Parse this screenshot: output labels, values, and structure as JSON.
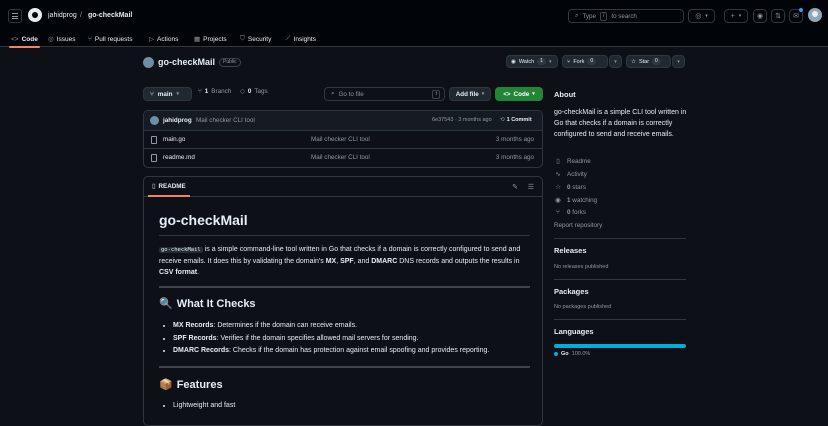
{
  "header": {
    "owner": "jahidprog",
    "separator": "/",
    "repo": "go-checkMail",
    "search_prefix": "Type",
    "search_key": "/",
    "search_suffix": "to search",
    "plus": "+",
    "caret": "▾"
  },
  "nav": {
    "tabs": [
      {
        "label": "Code",
        "icon": "code-icon"
      },
      {
        "label": "Issues",
        "icon": "issue-icon"
      },
      {
        "label": "Pull requests",
        "icon": "pull-request-icon"
      },
      {
        "label": "Actions",
        "icon": "play-icon"
      },
      {
        "label": "Projects",
        "icon": "table-icon"
      },
      {
        "label": "Security",
        "icon": "shield-icon"
      },
      {
        "label": "Insights",
        "icon": "graph-icon"
      }
    ]
  },
  "repo": {
    "name": "go-checkMail",
    "visibility": "Public",
    "watch_label": "Watch",
    "watch_count": "1",
    "fork_label": "Fork",
    "fork_count": "0",
    "star_label": "Star",
    "star_count": "0"
  },
  "toolbar": {
    "branch": "main",
    "branch_count": "1",
    "branch_label": "Branch",
    "tags_count": "0",
    "tags_label": "Tags",
    "goto_placeholder": "Go to file",
    "goto_key": "t",
    "add_file": "Add file",
    "code": "Code"
  },
  "commit": {
    "user": "jahidprog",
    "message": "Mail checker CLI tool",
    "hash": "6e37543",
    "dot": "·",
    "time": "3 months ago",
    "count": "1 Commit"
  },
  "files": [
    {
      "name": "main.go",
      "message": "Mail checker CLI tool",
      "time": "3 months ago"
    },
    {
      "name": "readme.md",
      "message": "Mail checker CLI tool",
      "time": "3 months ago"
    }
  ],
  "readme": {
    "tab": "README",
    "title": "go-checkMail",
    "intro_code": "go-checkMail",
    "intro_1": " is a simple command-line tool written in Go that checks if a domain is correctly configured to send and receive emails. It does this by validating the domain's ",
    "mx": "MX",
    "comma1": ", ",
    "spf": "SPF",
    "and": ", and ",
    "dmarc": "DMARC",
    "intro_2": " DNS records and outputs the results in ",
    "csv": "CSV format",
    "period": ".",
    "section1_emoji": "🔍",
    "section1": "What It Checks",
    "checks": [
      {
        "term": "MX Records",
        "desc": ": Determines if the domain can receive emails."
      },
      {
        "term": "SPF Records",
        "desc": ": Verifies if the domain specifies allowed mail servers for sending."
      },
      {
        "term": "DMARC Records",
        "desc": ": Checks if the domain has protection against email spoofing and provides reporting."
      }
    ],
    "section2_emoji": "📦",
    "section2": "Features",
    "features": [
      "Lightweight and fast"
    ]
  },
  "about": {
    "heading": "About",
    "description": "go-checkMail is a simple CLI tool written in Go that checks if a domain is correctly configured to send and receive emails.",
    "readme": "Readme",
    "activity": "Activity",
    "stars_count": "0",
    "stars_label": "stars",
    "watching_count": "1",
    "watching_label": "watching",
    "forks_count": "0",
    "forks_label": "forks",
    "report": "Report repository"
  },
  "releases": {
    "heading": "Releases",
    "empty": "No releases published"
  },
  "packages": {
    "heading": "Packages",
    "empty": "No packages published"
  },
  "languages": {
    "heading": "Languages",
    "items": [
      {
        "name": "Go",
        "percent": "100.0%",
        "color": "#00add8",
        "fraction": 1.0
      }
    ]
  }
}
